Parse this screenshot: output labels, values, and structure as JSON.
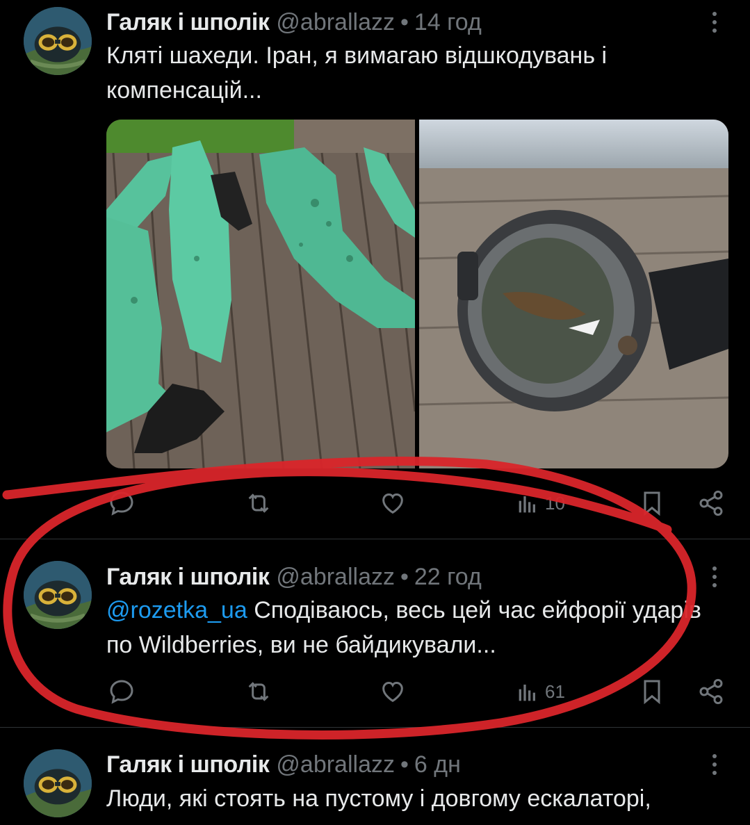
{
  "tweets": [
    {
      "name": "Галяк і шполік",
      "handle": "@abrallazz",
      "dot": "•",
      "time": "14 год",
      "text_line1": "Кляті шахеди. Іран, я вимагаю відшкодувань і",
      "text_line2": "компенсацій...",
      "views": "10"
    },
    {
      "name": "Галяк і шполік",
      "handle": "@abrallazz",
      "dot": "•",
      "time": "22 год",
      "mention": "@rozetka_ua",
      "text_line1_rest": " Сподіваюсь, весь цей час ейфорії ударів",
      "text_line2": "по Wildberries, ви не байдикували...",
      "views": "61"
    },
    {
      "name": "Галяк і шполік",
      "handle": "@abrallazz",
      "dot": "•",
      "time": "6 дн",
      "text_line1": "Люди, які стоять на пустому і довгому ескалаторі,"
    }
  ],
  "media": {
    "left": "wetsuit-on-deck-photo",
    "right": "cressi-dive-computer-photo"
  },
  "icons": [
    "reply-icon",
    "retweet-icon",
    "like-icon",
    "views-icon",
    "bookmark-icon",
    "share-icon",
    "more-icon"
  ],
  "colors": {
    "background": "#000000",
    "text": "#e7e9ea",
    "muted": "#71767b",
    "link": "#1d9bf0",
    "annotation": "#d9252a"
  }
}
